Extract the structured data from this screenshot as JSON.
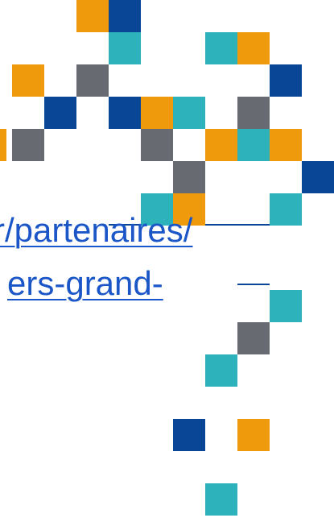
{
  "link": {
    "line1": "r/partenaires/",
    "line2": "ers-grand-"
  },
  "colors": {
    "orange": "#ee9a0c",
    "navy": "#0a4696",
    "teal": "#2db1bb",
    "gray": "#676a70",
    "link": "#1a56c8"
  }
}
